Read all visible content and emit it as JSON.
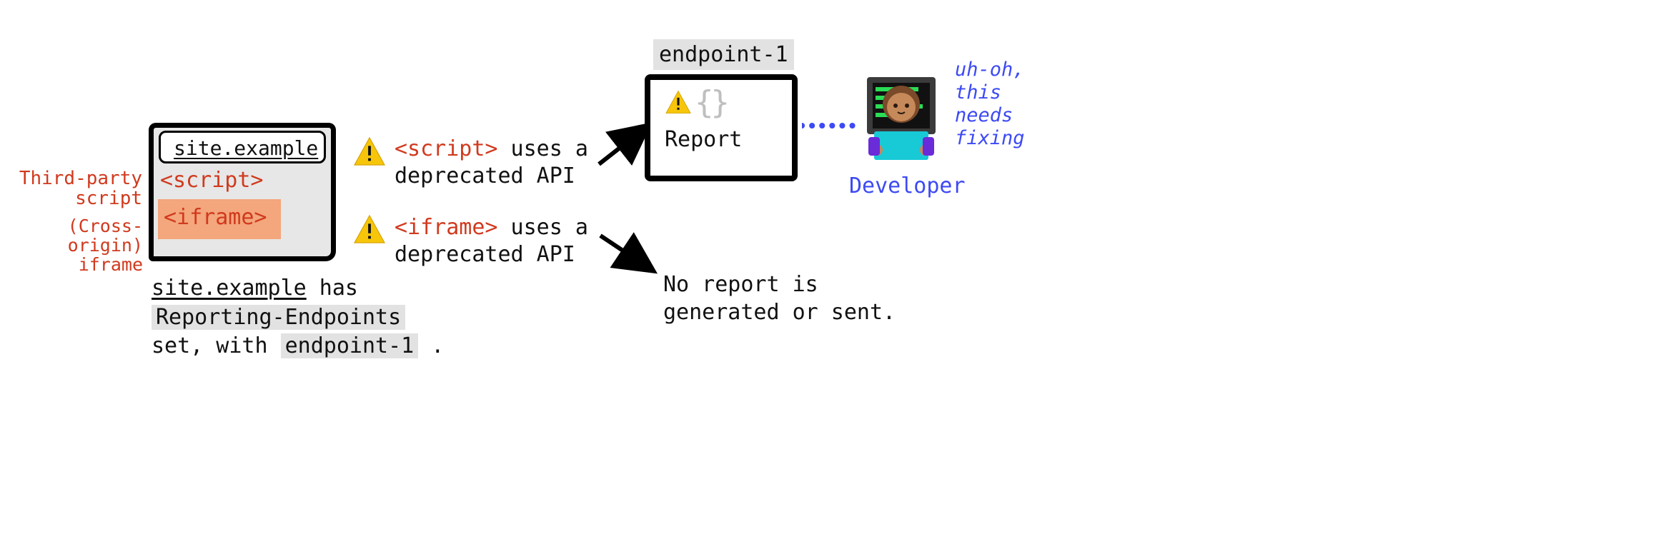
{
  "left": {
    "annotations": {
      "third_party": "Third-party",
      "third_party_2": "script",
      "cross_origin": "(Cross-origin)",
      "cross_origin_2": "iframe"
    },
    "browser": {
      "url": "site.example",
      "script_tag": "<script>",
      "iframe_tag": "<iframe>"
    },
    "caption": {
      "site": "site.example",
      "has": " has ",
      "hdr": "Reporting-Endpoints",
      "set_with": "set, with ",
      "endpoint": "endpoint-1",
      "dot": " ."
    }
  },
  "middle": {
    "line1a": "<script>",
    "line1b": " uses a",
    "line1c": "deprecated API",
    "line2a": "<iframe>",
    "line2b": " uses a",
    "line2c": "deprecated API"
  },
  "right": {
    "endpoint_label": "endpoint-1",
    "report": "Report",
    "no_report1": "No report is",
    "no_report2": "generated or sent."
  },
  "dev": {
    "label": "Developer",
    "thought1": "uh-oh,",
    "thought2": "this",
    "thought3": "needs",
    "thought4": "fixing"
  }
}
